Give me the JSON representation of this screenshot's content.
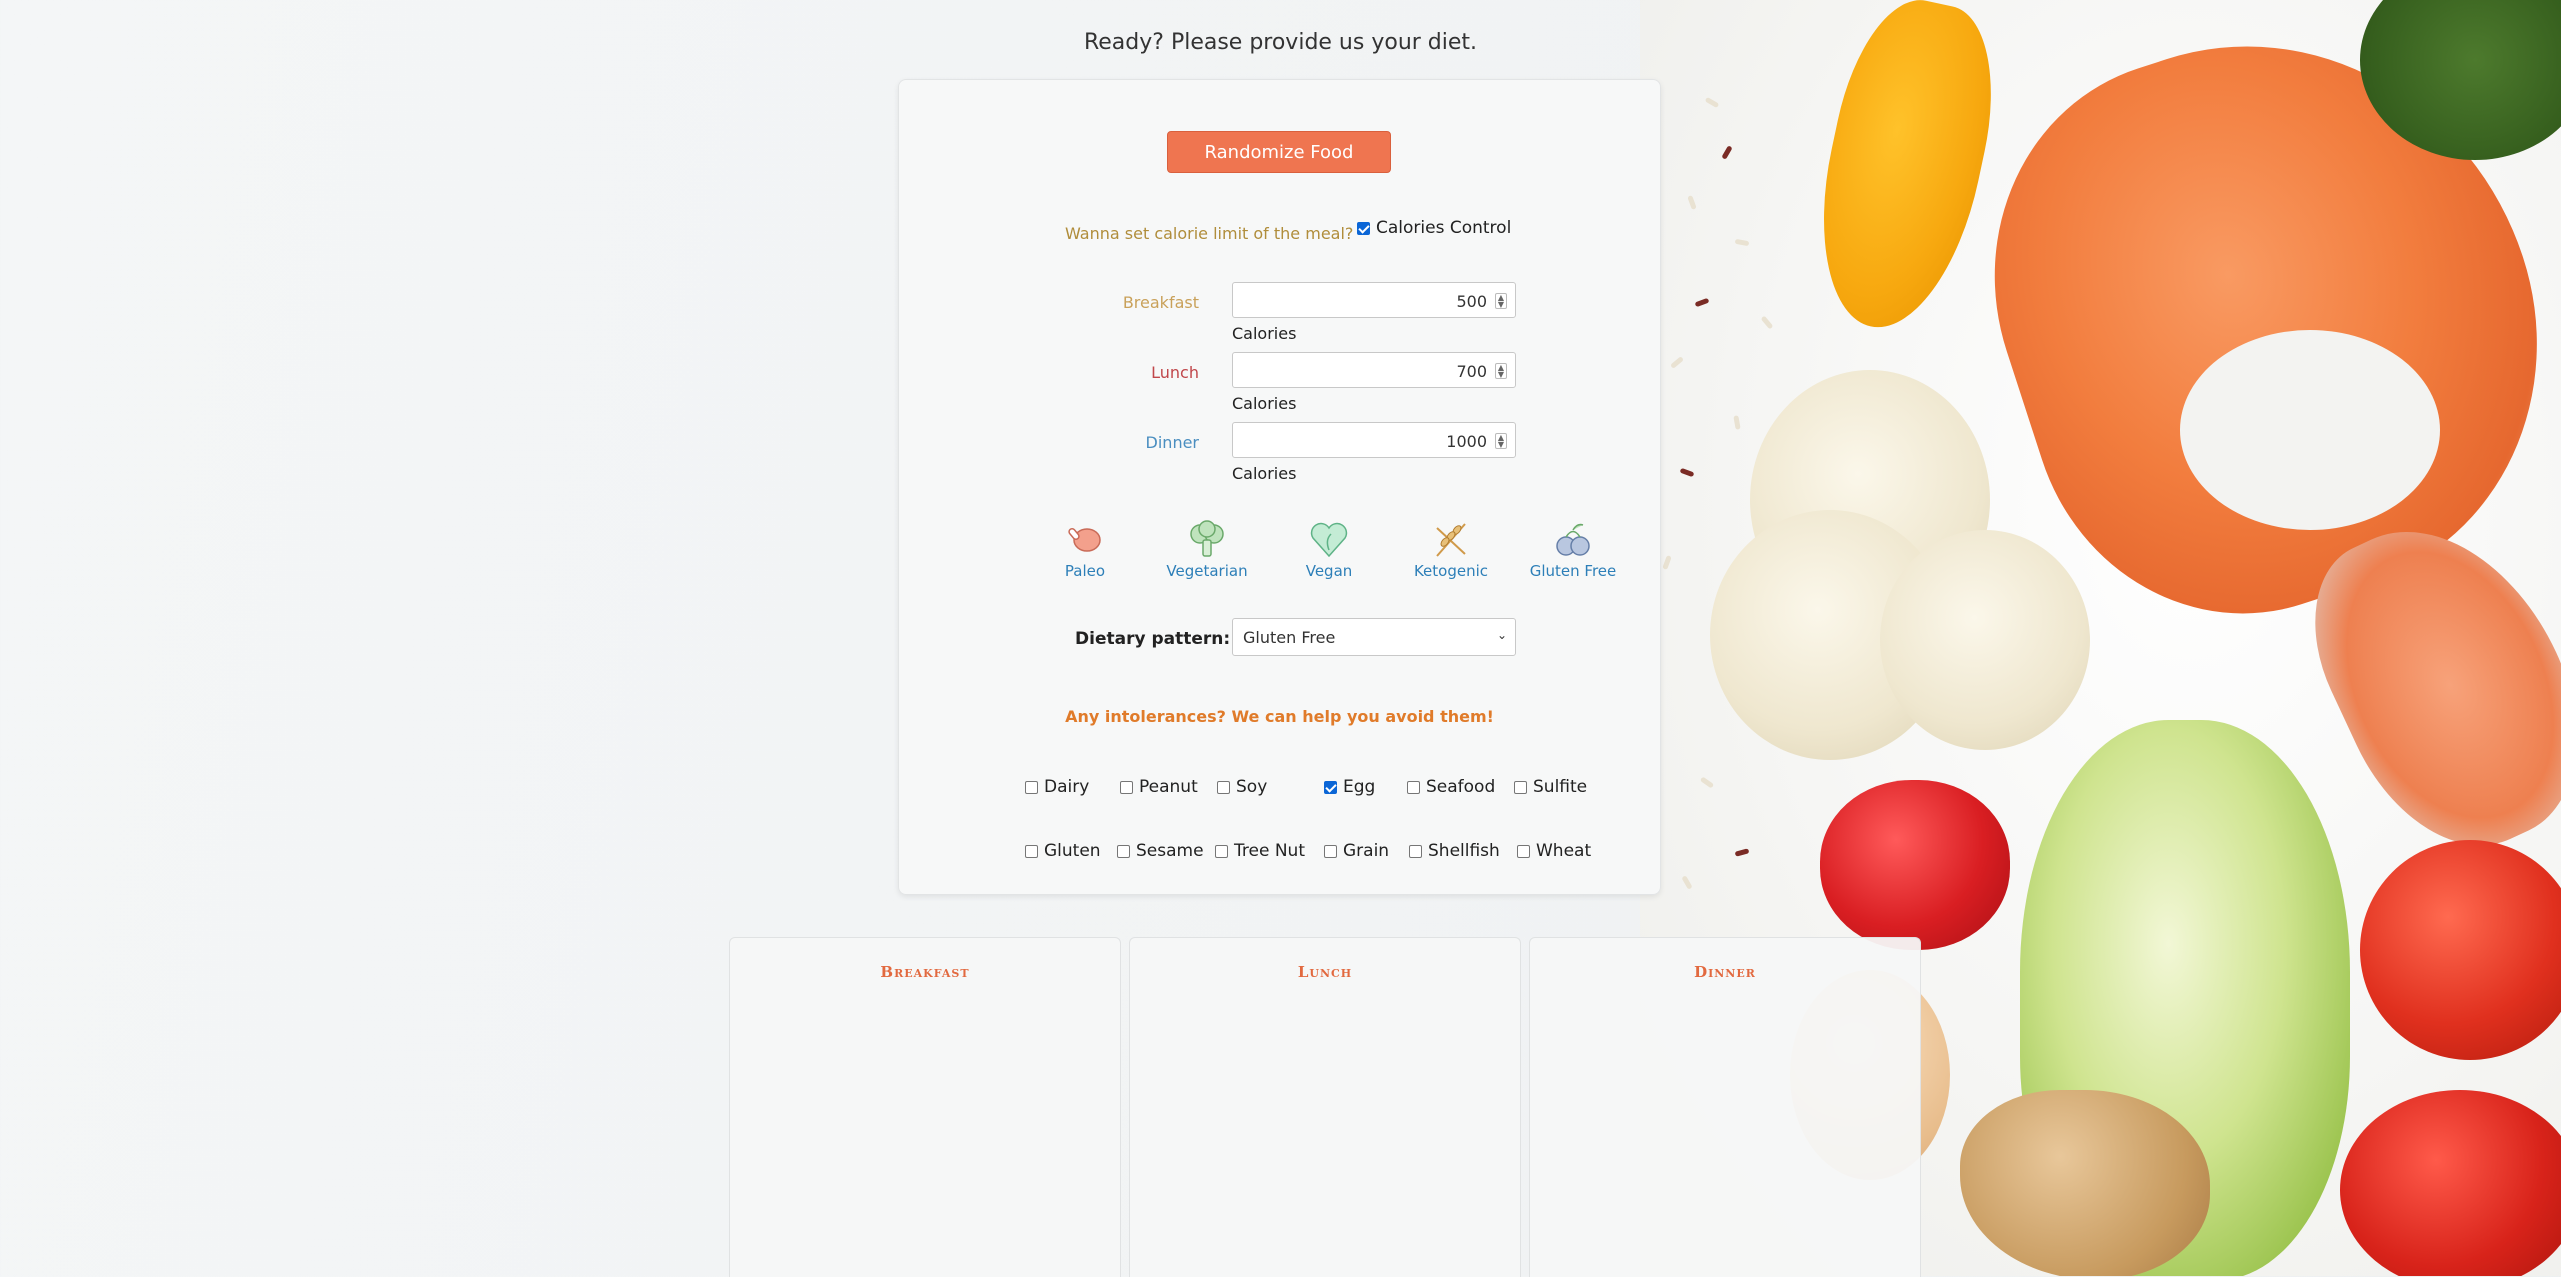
{
  "header": {
    "headline": "Ready? Please provide us your diet."
  },
  "form": {
    "randomize_label": "Randomize Food",
    "calorie_question": "Wanna set calorie limit of the meal?",
    "calories_control": {
      "label": "Calories Control",
      "checked": true
    },
    "meals": [
      {
        "label": "Breakfast",
        "value": "500",
        "unit": "Calories",
        "color": "#c9a15a"
      },
      {
        "label": "Lunch",
        "value": "700",
        "unit": "Calories",
        "color": "#c0474b"
      },
      {
        "label": "Dinner",
        "value": "1000",
        "unit": "Calories",
        "color": "#4a8ec0"
      }
    ],
    "diets": [
      {
        "label": "Paleo",
        "icon": "meat-leg-icon"
      },
      {
        "label": "Vegetarian",
        "icon": "broccoli-icon"
      },
      {
        "label": "Vegan",
        "icon": "heart-leaf-icon"
      },
      {
        "label": "Ketogenic",
        "icon": "wheat-crossed-icon"
      },
      {
        "label": "Gluten Free",
        "icon": "berries-icon"
      }
    ],
    "dietary_pattern": {
      "label": "Dietary pattern:",
      "selected": "Gluten Free"
    },
    "intolerance_question": "Any intolerances? We can help you avoid them!",
    "intolerances": [
      {
        "label": "Dairy",
        "checked": false
      },
      {
        "label": "Peanut",
        "checked": false
      },
      {
        "label": "Soy",
        "checked": false
      },
      {
        "label": "Egg",
        "checked": true
      },
      {
        "label": "Seafood",
        "checked": false
      },
      {
        "label": "Sulfite",
        "checked": false
      },
      {
        "label": "Gluten",
        "checked": false
      },
      {
        "label": "Sesame",
        "checked": false
      },
      {
        "label": "Tree Nut",
        "checked": false
      },
      {
        "label": "Grain",
        "checked": false
      },
      {
        "label": "Shellfish",
        "checked": false
      },
      {
        "label": "Wheat",
        "checked": false
      }
    ]
  },
  "panels": [
    {
      "title": "Breakfast"
    },
    {
      "title": "Lunch"
    },
    {
      "title": "Dinner"
    }
  ],
  "colors": {
    "accent": "#ef7550",
    "link_blue": "#2d7fb8",
    "gold": "#b08d3b",
    "orange": "#e07b2a"
  }
}
